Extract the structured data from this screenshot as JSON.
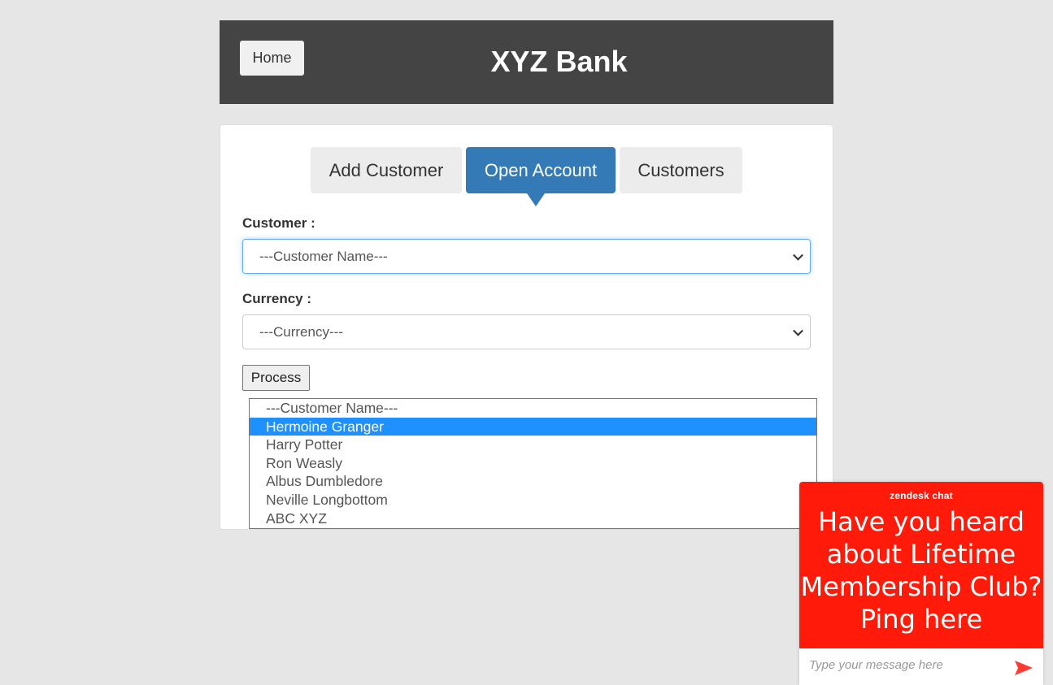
{
  "header": {
    "home_label": "Home",
    "title": "XYZ Bank"
  },
  "tabs": [
    {
      "label": "Add Customer",
      "active": false
    },
    {
      "label": "Open Account",
      "active": true
    },
    {
      "label": "Customers",
      "active": false
    }
  ],
  "form": {
    "customer_label": "Customer :",
    "customer_selected": "---Customer Name---",
    "currency_label": "Currency :",
    "currency_selected": "---Currency---",
    "process_label": "Process"
  },
  "customer_dropdown": {
    "options": [
      "---Customer Name---",
      "Hermoine Granger",
      "Harry Potter",
      "Ron Weasly",
      "Albus Dumbledore",
      "Neville Longbottom",
      "ABC XYZ"
    ],
    "highlighted": "Hermoine Granger"
  },
  "chat": {
    "brand": "zendesk chat",
    "headline": "Have you heard about Lifetime Membership Club? Ping here",
    "input_placeholder": "Type your message here",
    "send_icon": "send-arrow-icon",
    "accent_color": "#ff1a0a"
  },
  "colors": {
    "header_bg": "#444444",
    "active_tab": "#337ab7",
    "option_highlight": "#1e90ff"
  }
}
